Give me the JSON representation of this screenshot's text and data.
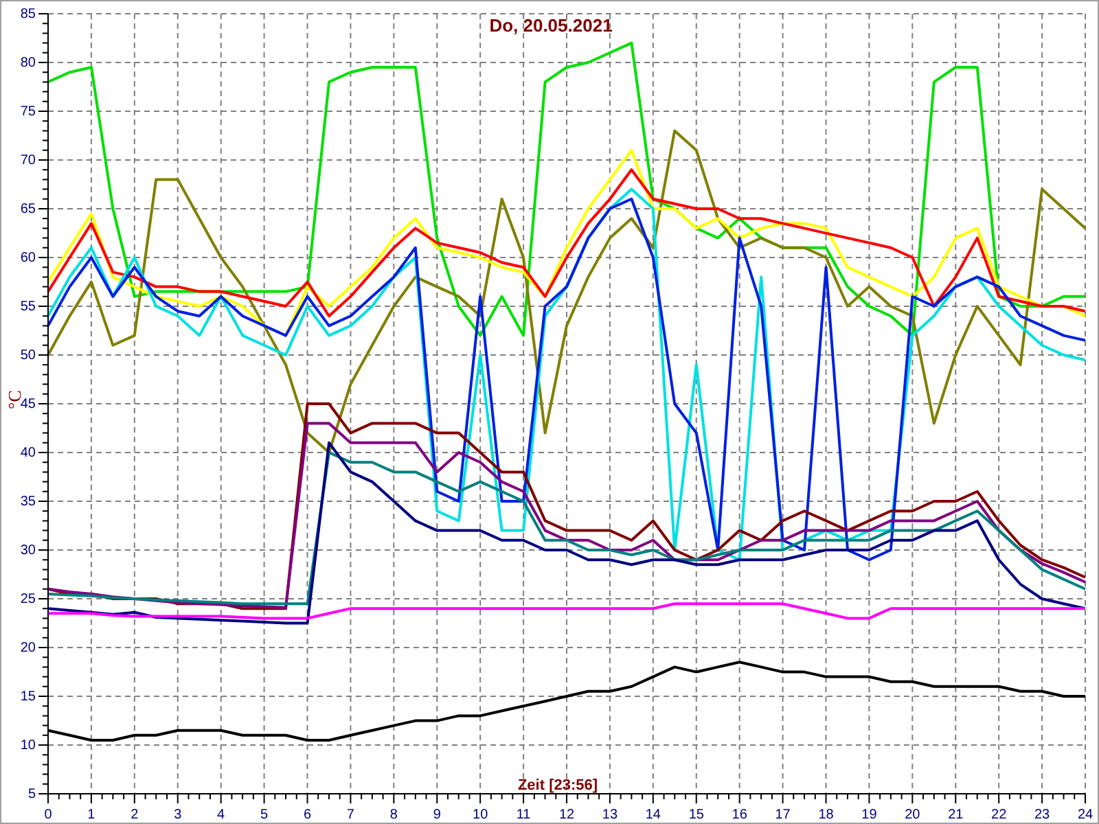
{
  "chart": {
    "chart_data": {
      "type": "line",
      "grid": true,
      "title": "Do, 20.05.2021",
      "xlabel": "Zeit [23:56]",
      "ylabel": "°C",
      "xlim": [
        0,
        24
      ],
      "ylim": [
        5,
        85
      ],
      "xticks": [
        0,
        1,
        2,
        3,
        4,
        5,
        6,
        7,
        8,
        9,
        10,
        11,
        12,
        13,
        14,
        15,
        16,
        17,
        18,
        19,
        20,
        21,
        22,
        23,
        24
      ],
      "yticks": [
        5,
        10,
        15,
        20,
        25,
        30,
        35,
        40,
        45,
        50,
        55,
        60,
        65,
        70,
        75,
        80,
        85
      ],
      "x": [
        0,
        0.5,
        1,
        1.5,
        2,
        2.5,
        3,
        3.5,
        4,
        4.5,
        5,
        5.5,
        6,
        6.5,
        7,
        7.5,
        8,
        8.5,
        9,
        9.5,
        10,
        10.5,
        11,
        11.5,
        12,
        12.5,
        13,
        13.5,
        14,
        14.5,
        15,
        15.5,
        16,
        16.5,
        17,
        17.5,
        18,
        18.5,
        19,
        19.5,
        20,
        20.5,
        21,
        21.5,
        22,
        22.5,
        23,
        23.5,
        24
      ],
      "series": [
        {
          "color": "#00e000",
          "values": [
            78,
            79,
            79.5,
            65,
            56,
            56.5,
            56.5,
            56.5,
            56.5,
            56.5,
            56.5,
            56.5,
            57,
            78,
            79,
            79.5,
            79.5,
            79.5,
            62,
            55,
            52,
            56,
            52,
            78,
            79.5,
            80,
            81,
            82,
            66,
            65,
            63,
            62,
            64,
            62,
            61,
            61,
            61,
            57,
            55,
            54,
            52,
            78,
            79.5,
            79.5,
            56,
            55,
            55,
            56,
            56
          ]
        },
        {
          "color": "#808000",
          "values": [
            50,
            54,
            57.5,
            51,
            52,
            68,
            68,
            64,
            60,
            57,
            53,
            49,
            42,
            40,
            47,
            51,
            55,
            58,
            57,
            56,
            54,
            66,
            60,
            42,
            53,
            58,
            62,
            64,
            61,
            73,
            71,
            64,
            61,
            62,
            61,
            61,
            60,
            55,
            57,
            55,
            54,
            43,
            50,
            55,
            52,
            49,
            67,
            65,
            63
          ]
        },
        {
          "color": "#ffff00",
          "values": [
            57.5,
            61,
            64.5,
            58,
            57,
            56,
            55.5,
            55,
            56,
            55,
            53,
            52,
            57,
            55,
            57,
            59,
            62,
            64,
            61,
            60.5,
            60,
            59,
            58.5,
            56,
            61,
            65,
            68,
            71,
            65,
            65,
            63,
            64,
            62,
            63,
            63.5,
            63.5,
            63,
            59,
            58,
            57,
            56,
            58,
            62,
            63,
            57,
            56,
            55,
            55,
            54
          ]
        },
        {
          "color": "#ff0000",
          "values": [
            56.5,
            60,
            63.5,
            58.5,
            58,
            57,
            57,
            56.5,
            56.5,
            56,
            55.5,
            55,
            57.5,
            54,
            56,
            58.5,
            61,
            63,
            61.5,
            61,
            60.5,
            59.5,
            59,
            56,
            60,
            63.5,
            66,
            69,
            66,
            65.5,
            65,
            65,
            64,
            64,
            63.5,
            63,
            62.5,
            62,
            61.5,
            61,
            60,
            55,
            58,
            62,
            56,
            55.5,
            55,
            55,
            54.5
          ]
        },
        {
          "color": "#00e0e0",
          "values": [
            54,
            58,
            61,
            56,
            60,
            55,
            54,
            52,
            56,
            52,
            51,
            50,
            55,
            52,
            53,
            55,
            58,
            60,
            34,
            33,
            50,
            32,
            32,
            54,
            57,
            62,
            65,
            67,
            65,
            30,
            49,
            30,
            29,
            58,
            30,
            31,
            32,
            31,
            32,
            32,
            52,
            54,
            57,
            58,
            55,
            53,
            51,
            50,
            49.5
          ]
        },
        {
          "color": "#0020e0",
          "values": [
            53,
            57,
            60,
            56,
            59,
            56,
            54.5,
            54,
            56,
            54,
            53,
            52,
            56,
            53,
            54,
            56,
            58,
            61,
            36,
            35,
            56,
            35,
            35,
            55,
            57,
            62,
            65,
            66,
            60,
            45,
            42,
            30,
            62,
            55,
            31,
            30,
            59,
            30,
            29,
            30,
            56,
            55,
            57,
            58,
            57,
            54,
            53,
            52,
            51.5
          ]
        },
        {
          "color": "#800000",
          "values": [
            26,
            25.5,
            25.5,
            25,
            25,
            25,
            24.5,
            24.5,
            24.5,
            24,
            24,
            24,
            45,
            45,
            42,
            43,
            43,
            43,
            42,
            42,
            40,
            38,
            38,
            33,
            32,
            32,
            32,
            31,
            33,
            30,
            29,
            30,
            32,
            31,
            33,
            34,
            33,
            32,
            33,
            34,
            34,
            35,
            35,
            36,
            33,
            30.5,
            29,
            28.2,
            27.2
          ]
        },
        {
          "color": "#800080",
          "values": [
            26,
            25.7,
            25.5,
            25.2,
            25,
            24.8,
            24.6,
            24.5,
            24.4,
            24.3,
            24.2,
            24.1,
            43,
            43,
            41,
            41,
            41,
            41,
            38,
            40,
            39,
            37,
            36,
            32,
            31,
            31,
            30,
            30,
            31,
            29,
            29,
            29,
            30,
            31,
            31,
            32,
            32,
            32,
            32,
            33,
            33,
            33,
            34,
            35,
            32,
            30,
            28.6,
            27.7,
            26.7
          ]
        },
        {
          "color": "#008080",
          "values": [
            25.5,
            25.4,
            25.3,
            25.1,
            25,
            24.9,
            24.8,
            24.7,
            24.6,
            24.5,
            24.5,
            24.5,
            24.5,
            40,
            39,
            39,
            38,
            38,
            37,
            36,
            37,
            36,
            35,
            31,
            31,
            30,
            30,
            29.5,
            30,
            29,
            29,
            29.5,
            30,
            30,
            30,
            31,
            31,
            31,
            31,
            32,
            32,
            32,
            33,
            34,
            32,
            30,
            28,
            27,
            26
          ]
        },
        {
          "color": "#000080",
          "values": [
            24,
            23.8,
            23.6,
            23.4,
            23.6,
            23.1,
            23,
            22.9,
            22.8,
            22.7,
            22.6,
            22.5,
            22.5,
            41,
            38,
            37,
            35,
            33,
            32,
            32,
            32,
            31,
            31,
            30,
            30,
            29,
            29,
            28.5,
            29,
            29,
            28.5,
            28.5,
            29,
            29,
            29,
            29.5,
            30,
            30,
            30,
            31,
            31,
            32,
            32,
            33,
            29,
            26.5,
            25,
            24.5,
            24
          ]
        },
        {
          "color": "#ff00ff",
          "values": [
            23.5,
            23.5,
            23.5,
            23.3,
            23.2,
            23.2,
            23.2,
            23.2,
            23.2,
            23.1,
            23,
            23,
            23,
            23.5,
            24,
            24,
            24,
            24,
            24,
            24,
            24,
            24,
            24,
            24,
            24,
            24,
            24,
            24,
            24,
            24.5,
            24.5,
            24.5,
            24.5,
            24.5,
            24.5,
            24,
            23.5,
            23,
            23,
            24,
            24,
            24,
            24,
            24,
            24,
            24,
            24,
            24,
            24
          ]
        },
        {
          "color": "#000000",
          "values": [
            11.5,
            11,
            10.5,
            10.5,
            11,
            11,
            11.5,
            11.5,
            11.5,
            11,
            11,
            11,
            10.5,
            10.5,
            11,
            11.5,
            12,
            12.5,
            12.5,
            13,
            13,
            13.5,
            14,
            14.5,
            15,
            15.5,
            15.5,
            16,
            17,
            18,
            17.5,
            18,
            18.5,
            18,
            17.5,
            17.5,
            17,
            17,
            17,
            16.5,
            16.5,
            16,
            16,
            16,
            16,
            15.5,
            15.5,
            15,
            15
          ]
        }
      ]
    }
  }
}
